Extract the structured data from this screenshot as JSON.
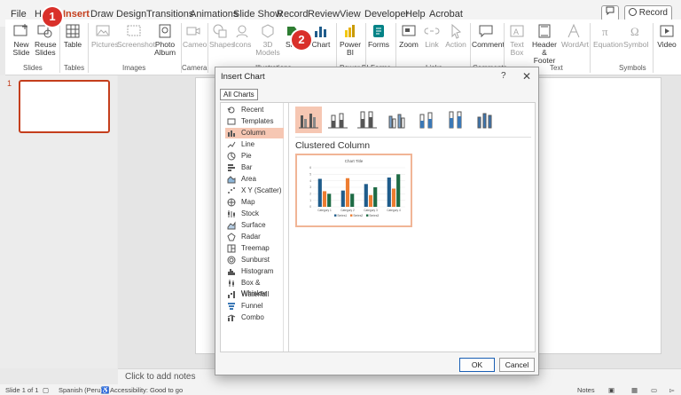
{
  "menubar": {
    "tabs": [
      "File",
      "Home",
      "Insert",
      "Draw",
      "Design",
      "Transitions",
      "Animations",
      "Slide Show",
      "Record",
      "Review",
      "View",
      "Developer",
      "Help",
      "Acrobat"
    ],
    "active_tab": "Insert",
    "record_button": "Record"
  },
  "callouts": {
    "one": "1",
    "two": "2"
  },
  "ribbon": {
    "new_slide": "New Slide",
    "reuse_slides": "Reuse Slides",
    "table": "Table",
    "pictures": "Pictures",
    "screenshot": "Screenshot",
    "photo_album": "Photo Album",
    "cameo": "Cameo",
    "shapes": "Shapes",
    "icons": "Icons",
    "models_3d": "3D Models",
    "smartart": "SmartArt",
    "chart": "Chart",
    "power_bi": "Power BI",
    "forms": "Forms",
    "zoom": "Zoom",
    "link": "Link",
    "action": "Action",
    "comment": "Comment",
    "text_box": "Text Box",
    "header_footer": "Header & Footer",
    "wordart": "WordArt",
    "equation": "Equation",
    "symbol": "Symbol",
    "video": "Video",
    "groups": {
      "slides": "Slides",
      "tables": "Tables",
      "images": "Images",
      "camera": "Camera",
      "illustrations": "Illustrations",
      "power_bi": "Power BI",
      "forms": "Forms",
      "links": "Links",
      "comments": "Comments",
      "text": "Text",
      "symbols": "Symbols"
    }
  },
  "thumbnail": {
    "number": "1"
  },
  "notes_placeholder": "Click to add notes",
  "statusbar": {
    "slide_info": "Slide 1 of 1",
    "language": "Spanish (Peru)",
    "accessibility": "Accessibility: Good to go",
    "notes": "Notes"
  },
  "dialog": {
    "title": "Insert Chart",
    "help": "?",
    "close": "✕",
    "tab_label": "All Charts",
    "chart_types": [
      "Recent",
      "Templates",
      "Column",
      "Line",
      "Pie",
      "Bar",
      "Area",
      "X Y (Scatter)",
      "Map",
      "Stock",
      "Surface",
      "Radar",
      "Treemap",
      "Sunburst",
      "Histogram",
      "Box & Whisker",
      "Waterfall",
      "Funnel",
      "Combo"
    ],
    "selected_type": "Column",
    "selected_subtype_heading": "Clustered Column",
    "ok_label": "OK",
    "cancel_label": "Cancel",
    "preview": {
      "title": "Chart Title",
      "series": [
        "Series1",
        "Series2",
        "Series3"
      ]
    }
  },
  "chart_data": {
    "type": "bar",
    "title": "Chart Title",
    "categories": [
      "Category 1",
      "Category 2",
      "Category 3",
      "Category 4"
    ],
    "series": [
      {
        "name": "Series1",
        "values": [
          4.3,
          2.5,
          3.5,
          4.5
        ]
      },
      {
        "name": "Series2",
        "values": [
          2.4,
          4.4,
          1.8,
          2.8
        ]
      },
      {
        "name": "Series3",
        "values": [
          2,
          2,
          3,
          5
        ]
      }
    ],
    "ylim": [
      0,
      6
    ],
    "yticks": [
      0,
      1,
      2,
      3,
      4,
      5,
      6
    ],
    "colors": [
      "#1f5c8b",
      "#ed7d31",
      "#1e6b45"
    ],
    "legend": "bottom",
    "grid": true
  }
}
